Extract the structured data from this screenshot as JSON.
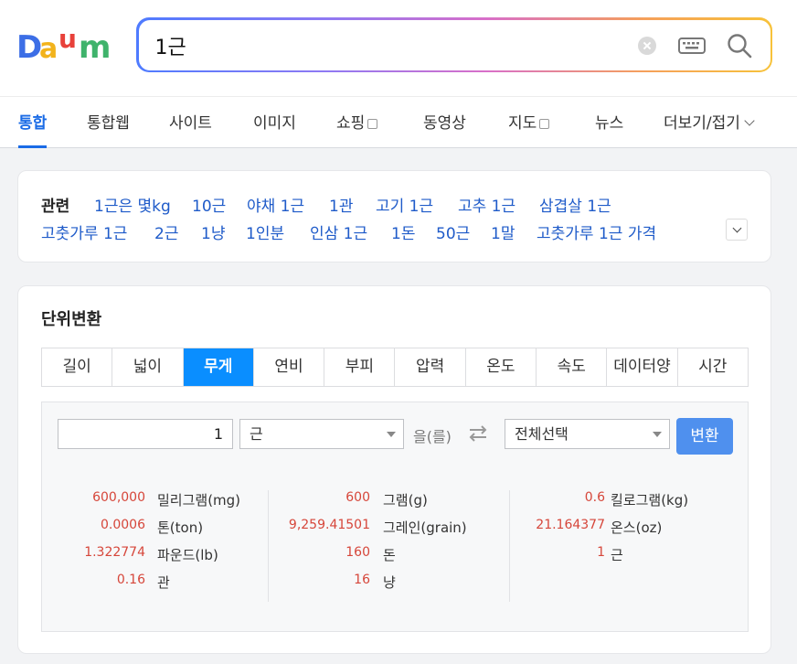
{
  "search": {
    "query": "1근"
  },
  "logo": {
    "text": "Daum",
    "colors": [
      "#3c6ee6",
      "#f2b31c",
      "#e8413a",
      "#3fb36b",
      "#8a56d8"
    ]
  },
  "tabs": [
    {
      "label": "통합",
      "active": true
    },
    {
      "label": "통합웹"
    },
    {
      "label": "사이트"
    },
    {
      "label": "이미지"
    },
    {
      "label": "쇼핑",
      "box": true
    },
    {
      "label": "동영상"
    },
    {
      "label": "지도",
      "box": true
    },
    {
      "label": "뉴스"
    },
    {
      "label": "더보기/접기",
      "chevron": true
    }
  ],
  "related": {
    "title": "관련",
    "row1": [
      "1근은 몇kg",
      "10근",
      "야채 1근",
      "1관",
      "고기 1근",
      "고추 1근",
      "삼겹살 1근"
    ],
    "row2": [
      "고춧가루 1근",
      "2근",
      "1냥",
      "1인분",
      "인삼 1근",
      "1돈",
      "50근",
      "1말",
      "고춧가루 1근 가격"
    ]
  },
  "unit_converter": {
    "title": "단위변환",
    "tabs": [
      "길이",
      "넓이",
      "무게",
      "연비",
      "부피",
      "압력",
      "온도",
      "속도",
      "데이터양",
      "시간"
    ],
    "active_tab": "무게",
    "input_value": "1",
    "from_unit": "근",
    "eul_label": "을(를)",
    "to_unit": "전체선택",
    "convert_label": "변환",
    "results": [
      [
        {
          "value": "600,000",
          "unit": "밀리그램(mg)"
        },
        {
          "value": "0.0006",
          "unit": "톤(ton)"
        },
        {
          "value": "1.322774",
          "unit": "파운드(lb)"
        },
        {
          "value": "0.16",
          "unit": "관"
        }
      ],
      [
        {
          "value": "600",
          "unit": "그램(g)"
        },
        {
          "value": "9,259.41501",
          "unit": "그레인(grain)"
        },
        {
          "value": "160",
          "unit": "돈"
        },
        {
          "value": "16",
          "unit": "냥"
        }
      ],
      [
        {
          "value": "0.6",
          "unit": "킬로그램(kg)"
        },
        {
          "value": "21.164377",
          "unit": "온스(oz)"
        },
        {
          "value": "1",
          "unit": "근"
        }
      ]
    ]
  },
  "colors": {
    "accent": "#1a6be6",
    "active_tab_bg": "#0a8eff",
    "link": "#1f5bc9",
    "result_value": "#d6463a",
    "convert_button": "#4f90ee"
  }
}
